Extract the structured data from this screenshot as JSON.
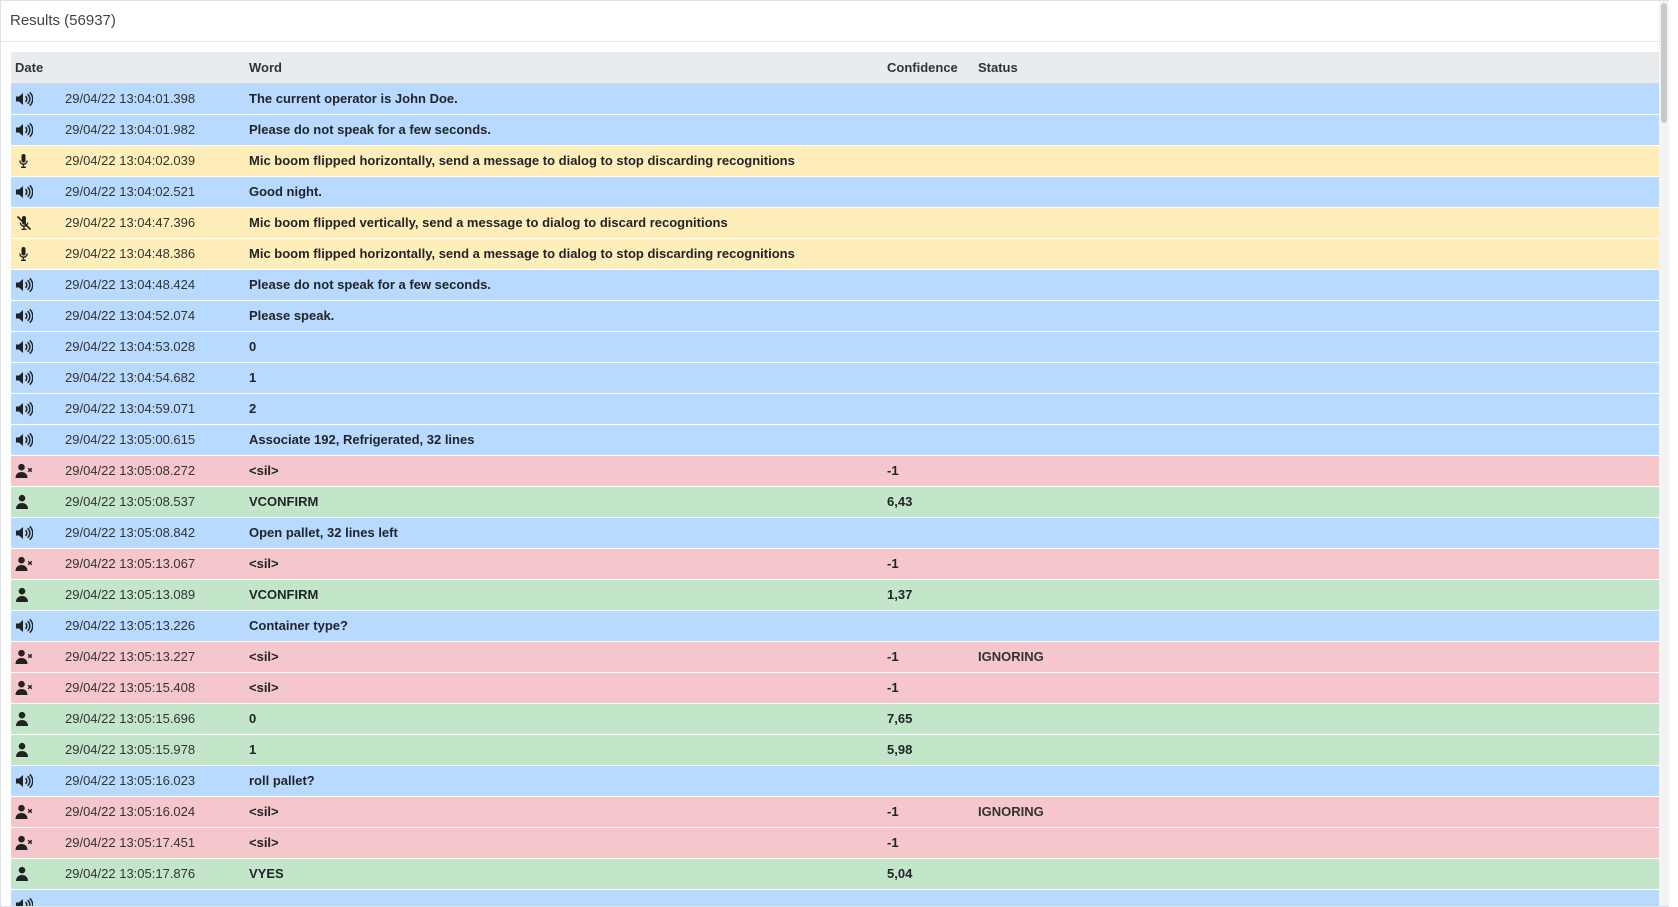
{
  "panel": {
    "title": "Results (56937)"
  },
  "table": {
    "columns": {
      "date": "Date",
      "word": "Word",
      "confidence": "Confidence",
      "status": "Status"
    },
    "rows": [
      {
        "type": "prompt",
        "icon": "speaker-icon",
        "date": "29/04/22 13:04:01.398",
        "word": "The current operator is John Doe.",
        "confidence": "",
        "status": ""
      },
      {
        "type": "prompt",
        "icon": "speaker-icon",
        "date": "29/04/22 13:04:01.982",
        "word": "Please do not speak for a few seconds.",
        "confidence": "",
        "status": ""
      },
      {
        "type": "event",
        "icon": "microphone-icon",
        "date": "29/04/22 13:04:02.039",
        "word": "Mic boom flipped horizontally, send a message to dialog to stop discarding recognitions",
        "confidence": "",
        "status": ""
      },
      {
        "type": "prompt",
        "icon": "speaker-icon",
        "date": "29/04/22 13:04:02.521",
        "word": "Good night.",
        "confidence": "",
        "status": ""
      },
      {
        "type": "event",
        "icon": "microphone-slash-icon",
        "date": "29/04/22 13:04:47.396",
        "word": "Mic boom flipped vertically, send a message to dialog to discard recognitions",
        "confidence": "",
        "status": ""
      },
      {
        "type": "event",
        "icon": "microphone-icon",
        "date": "29/04/22 13:04:48.386",
        "word": "Mic boom flipped horizontally, send a message to dialog to stop discarding recognitions",
        "confidence": "",
        "status": ""
      },
      {
        "type": "prompt",
        "icon": "speaker-icon",
        "date": "29/04/22 13:04:48.424",
        "word": "Please do not speak for a few seconds.",
        "confidence": "",
        "status": ""
      },
      {
        "type": "prompt",
        "icon": "speaker-icon",
        "date": "29/04/22 13:04:52.074",
        "word": "Please speak.",
        "confidence": "",
        "status": ""
      },
      {
        "type": "prompt",
        "icon": "speaker-icon",
        "date": "29/04/22 13:04:53.028",
        "word": "0",
        "confidence": "",
        "status": ""
      },
      {
        "type": "prompt",
        "icon": "speaker-icon",
        "date": "29/04/22 13:04:54.682",
        "word": "1",
        "confidence": "",
        "status": ""
      },
      {
        "type": "prompt",
        "icon": "speaker-icon",
        "date": "29/04/22 13:04:59.071",
        "word": "2",
        "confidence": "",
        "status": ""
      },
      {
        "type": "prompt",
        "icon": "speaker-icon",
        "date": "29/04/22 13:05:00.615",
        "word": "Associate 192, Refrigerated, 32 lines",
        "confidence": "",
        "status": ""
      },
      {
        "type": "reject",
        "icon": "user-times-icon",
        "date": "29/04/22 13:05:08.272",
        "word": "<sil>",
        "confidence": "-1",
        "status": ""
      },
      {
        "type": "accept",
        "icon": "user-icon",
        "date": "29/04/22 13:05:08.537",
        "word": "VCONFIRM",
        "confidence": "6,43",
        "status": ""
      },
      {
        "type": "prompt",
        "icon": "speaker-icon",
        "date": "29/04/22 13:05:08.842",
        "word": "Open pallet, 32 lines left",
        "confidence": "",
        "status": ""
      },
      {
        "type": "reject",
        "icon": "user-times-icon",
        "date": "29/04/22 13:05:13.067",
        "word": "<sil>",
        "confidence": "-1",
        "status": ""
      },
      {
        "type": "accept",
        "icon": "user-icon",
        "date": "29/04/22 13:05:13.089",
        "word": "VCONFIRM",
        "confidence": "1,37",
        "status": ""
      },
      {
        "type": "prompt",
        "icon": "speaker-icon",
        "date": "29/04/22 13:05:13.226",
        "word": "Container type?",
        "confidence": "",
        "status": ""
      },
      {
        "type": "reject",
        "icon": "user-times-icon",
        "date": "29/04/22 13:05:13.227",
        "word": "<sil>",
        "confidence": "-1",
        "status": "IGNORING"
      },
      {
        "type": "reject",
        "icon": "user-times-icon",
        "date": "29/04/22 13:05:15.408",
        "word": "<sil>",
        "confidence": "-1",
        "status": ""
      },
      {
        "type": "accept",
        "icon": "user-icon",
        "date": "29/04/22 13:05:15.696",
        "word": "0",
        "confidence": "7,65",
        "status": ""
      },
      {
        "type": "accept",
        "icon": "user-icon",
        "date": "29/04/22 13:05:15.978",
        "word": "1",
        "confidence": "5,98",
        "status": ""
      },
      {
        "type": "prompt",
        "icon": "speaker-icon",
        "date": "29/04/22 13:05:16.023",
        "word": "roll pallet?",
        "confidence": "",
        "status": ""
      },
      {
        "type": "reject",
        "icon": "user-times-icon",
        "date": "29/04/22 13:05:16.024",
        "word": "<sil>",
        "confidence": "-1",
        "status": "IGNORING"
      },
      {
        "type": "reject",
        "icon": "user-times-icon",
        "date": "29/04/22 13:05:17.451",
        "word": "<sil>",
        "confidence": "-1",
        "status": ""
      },
      {
        "type": "accept",
        "icon": "user-icon",
        "date": "29/04/22 13:05:17.876",
        "word": "VYES",
        "confidence": "5,04",
        "status": ""
      },
      {
        "type": "prompt",
        "icon": "speaker-icon",
        "date": "",
        "word": "",
        "confidence": "",
        "status": ""
      }
    ]
  },
  "colors": {
    "prompt_row": "#b8daff",
    "event_row": "#ffeeba",
    "reject_row": "#f5c6cb",
    "accept_row": "#c3e6cb",
    "header_row": "#e9ecef"
  }
}
